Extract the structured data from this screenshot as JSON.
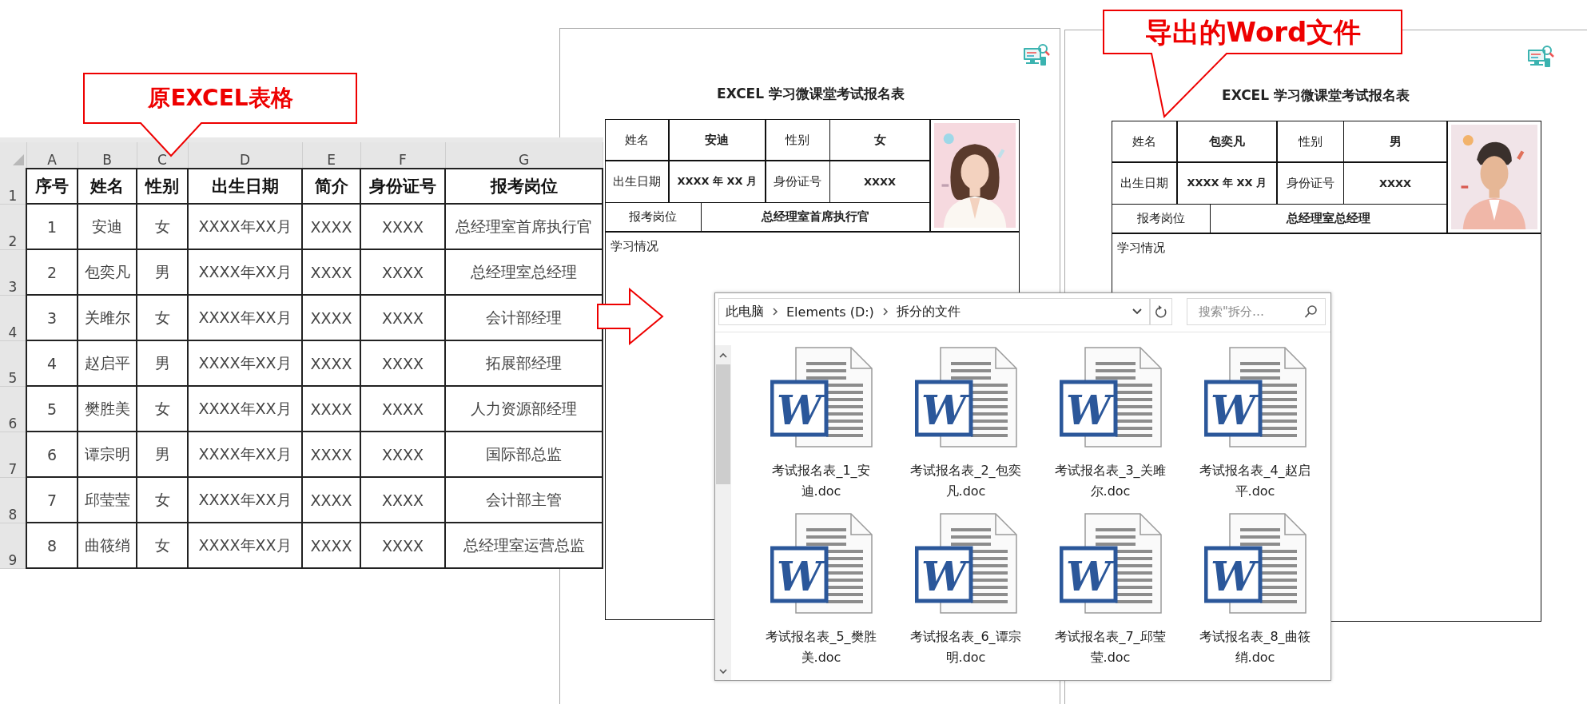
{
  "annotations": [
    {
      "text": "原EXCEL表格"
    },
    {
      "text": "导出的Word文件"
    }
  ],
  "spreadsheet": {
    "column_letters": [
      "A",
      "B",
      "C",
      "D",
      "E",
      "F",
      "G"
    ],
    "row_numbers": [
      "1",
      "2",
      "3",
      "4",
      "5",
      "6",
      "7",
      "8",
      "9"
    ],
    "header": [
      "序号",
      "姓名",
      "性别",
      "出生日期",
      "简介",
      "身份证号",
      "报考岗位"
    ],
    "rows": [
      [
        "1",
        "安迪",
        "女",
        "XXXX年XX月",
        "XXXX",
        "XXXX",
        "总经理室首席执行官"
      ],
      [
        "2",
        "包奕凡",
        "男",
        "XXXX年XX月",
        "XXXX",
        "XXXX",
        "总经理室总经理"
      ],
      [
        "3",
        "关雎尔",
        "女",
        "XXXX年XX月",
        "XXXX",
        "XXXX",
        "会计部经理"
      ],
      [
        "4",
        "赵启平",
        "男",
        "XXXX年XX月",
        "XXXX",
        "XXXX",
        "拓展部经理"
      ],
      [
        "5",
        "樊胜美",
        "女",
        "XXXX年XX月",
        "XXXX",
        "XXXX",
        "人力资源部经理"
      ],
      [
        "6",
        "谭宗明",
        "男",
        "XXXX年XX月",
        "XXXX",
        "XXXX",
        "国际部总监"
      ],
      [
        "7",
        "邱莹莹",
        "女",
        "XXXX年XX月",
        "XXXX",
        "XXXX",
        "会计部主管"
      ],
      [
        "8",
        "曲筱绡",
        "女",
        "XXXX年XX月",
        "XXXX",
        "XXXX",
        "总经理室运营总监"
      ]
    ]
  },
  "documents": [
    {
      "title": "EXCEL 学习微课堂考试报名表",
      "name_label": "姓名",
      "name": "安迪",
      "gender_label": "性别",
      "gender": "女",
      "birth_label": "出生日期",
      "birth": "XXXX 年 XX 月",
      "id_label": "身份证号",
      "id": "XXXX",
      "position_label": "报考岗位",
      "position": "总经理室首席执行官",
      "study_label": "学习情况"
    },
    {
      "title": "EXCEL 学习微课堂考试报名表",
      "name_label": "姓名",
      "name": "包奕凡",
      "gender_label": "性别",
      "gender": "男",
      "birth_label": "出生日期",
      "birth": "XXXX 年 XX 月",
      "id_label": "身份证号",
      "id": "XXXX",
      "position_label": "报考岗位",
      "position": "总经理室总经理",
      "study_label": "学习情况"
    }
  ],
  "explorer": {
    "breadcrumb": [
      "此电脑",
      "Elements (D:)",
      "拆分的文件"
    ],
    "search": {
      "placeholder": "搜索\"拆分…"
    },
    "files": [
      {
        "icon_letter": "W",
        "name": "考试报名表_1_安迪.doc"
      },
      {
        "icon_letter": "W",
        "name": "考试报名表_2_包奕凡.doc"
      },
      {
        "icon_letter": "W",
        "name": "考试报名表_3_关雎尔.doc"
      },
      {
        "icon_letter": "W",
        "name": "考试报名表_4_赵启平.doc"
      },
      {
        "icon_letter": "W",
        "name": "考试报名表_5_樊胜美.doc"
      },
      {
        "icon_letter": "W",
        "name": "考试报名表_6_谭宗明.doc"
      },
      {
        "icon_letter": "W",
        "name": "考试报名表_7_邱莹莹.doc"
      },
      {
        "icon_letter": "W",
        "name": "考试报名表_8_曲筱绡.doc"
      }
    ]
  }
}
